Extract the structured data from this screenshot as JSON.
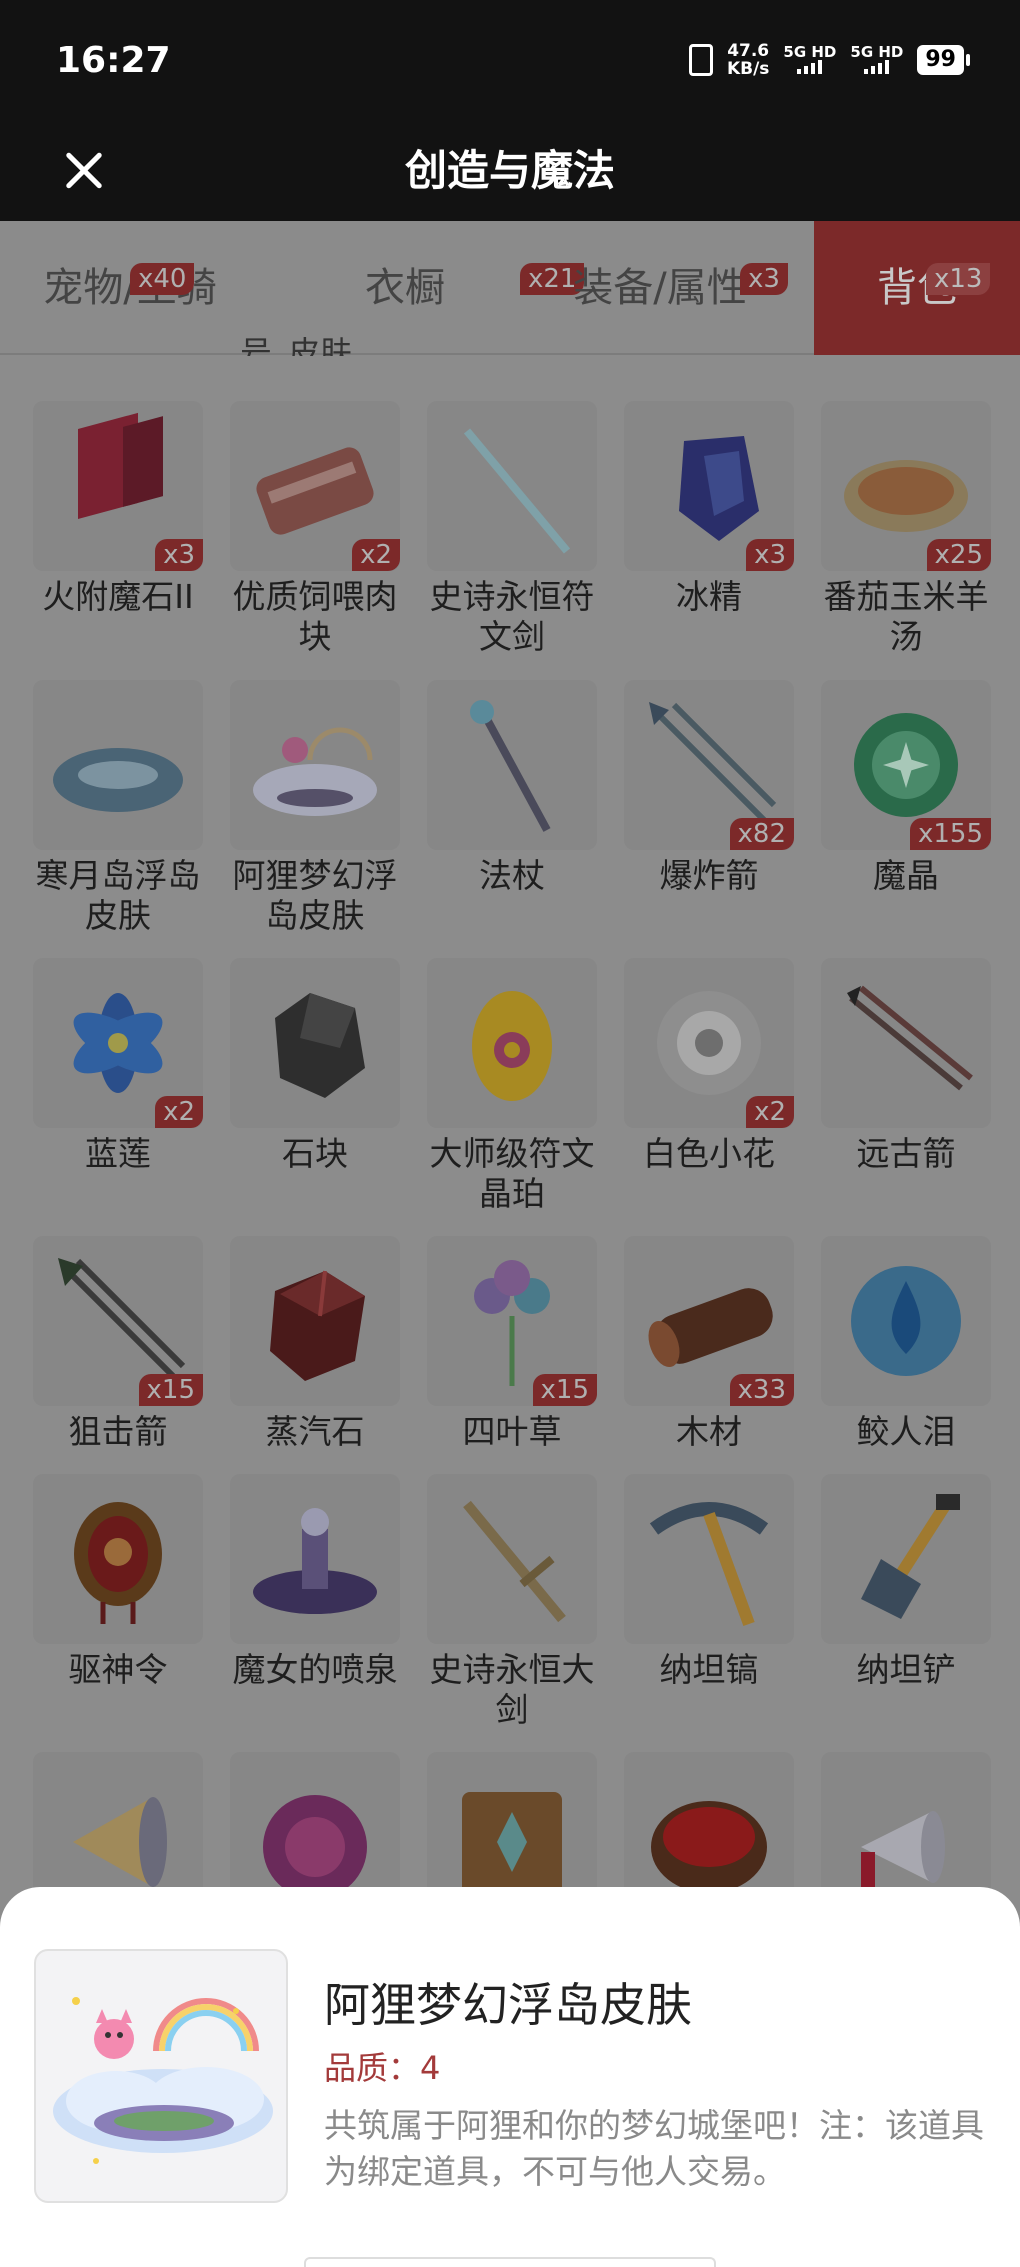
{
  "status_bar": {
    "time": "16:27",
    "speed_value": "47.6",
    "speed_unit": "KB/s",
    "net1": "5G HD",
    "net2": "5G HD",
    "battery": "99"
  },
  "header": {
    "title": "创造与魔法"
  },
  "tabs": [
    {
      "label": "宠物/坐骑",
      "badge": "x40",
      "active": false
    },
    {
      "label": "衣橱",
      "badge": "x21",
      "active": false
    },
    {
      "label": "装备/属性",
      "badge": "x3",
      "active": false
    },
    {
      "label": "背包",
      "badge": "x13",
      "active": true
    }
  ],
  "partial_text": "号_皮肤",
  "items": [
    {
      "name": "火附魔石II",
      "count": "x3",
      "icon": "red-crystal-icon"
    },
    {
      "name": "优质饲喂肉块",
      "count": "x2",
      "icon": "meat-icon"
    },
    {
      "name": "史诗永恒符文剑",
      "count": "",
      "icon": "rune-sword-icon"
    },
    {
      "name": "冰精",
      "count": "x3",
      "icon": "ice-crystal-icon"
    },
    {
      "name": "番茄玉米羊汤",
      "count": "x25",
      "icon": "soup-icon"
    },
    {
      "name": "寒月岛浮岛皮肤",
      "count": "",
      "icon": "floating-island-icon"
    },
    {
      "name": "阿狸梦幻浮岛皮肤",
      "count": "",
      "icon": "cloud-island-icon"
    },
    {
      "name": "法杖",
      "count": "",
      "icon": "staff-icon"
    },
    {
      "name": "爆炸箭",
      "count": "x82",
      "icon": "arrow-icon"
    },
    {
      "name": "魔晶",
      "count": "x155",
      "icon": "magic-crystal-icon"
    },
    {
      "name": "蓝莲",
      "count": "x2",
      "icon": "blue-lotus-icon"
    },
    {
      "name": "石块",
      "count": "",
      "icon": "stone-icon"
    },
    {
      "name": "大师级符文晶珀",
      "count": "",
      "icon": "amber-egg-icon"
    },
    {
      "name": "白色小花",
      "count": "x2",
      "icon": "white-flower-icon"
    },
    {
      "name": "远古箭",
      "count": "",
      "icon": "ancient-arrow-icon"
    },
    {
      "name": "狙击箭",
      "count": "x15",
      "icon": "sniper-arrow-icon"
    },
    {
      "name": "蒸汽石",
      "count": "",
      "icon": "steam-stone-icon"
    },
    {
      "name": "四叶草",
      "count": "x15",
      "icon": "clover-icon"
    },
    {
      "name": "木材",
      "count": "x33",
      "icon": "wood-log-icon"
    },
    {
      "name": "鲛人泪",
      "count": "",
      "icon": "water-drop-icon"
    },
    {
      "name": "驱神令",
      "count": "",
      "icon": "emblem-icon"
    },
    {
      "name": "魔女的喷泉",
      "count": "",
      "icon": "fountain-icon"
    },
    {
      "name": "史诗永恒大剑",
      "count": "",
      "icon": "great-sword-icon"
    },
    {
      "name": "纳坦镐",
      "count": "",
      "icon": "pickaxe-icon"
    },
    {
      "name": "纳坦铲",
      "count": "",
      "icon": "shovel-icon"
    },
    {
      "name": "",
      "count": "",
      "icon": "megaphone-icon"
    },
    {
      "name": "",
      "count": "",
      "icon": "berry-icon"
    },
    {
      "name": "",
      "count": "",
      "icon": "scroll-icon"
    },
    {
      "name": "",
      "count": "",
      "icon": "red-drum-icon"
    },
    {
      "name": "",
      "count": "",
      "icon": "loudspeaker-icon"
    }
  ],
  "detail": {
    "name": "阿狸梦幻浮岛皮肤",
    "quality": "品质：4",
    "description": "共筑属于阿狸和你的梦幻城堡吧！注：该道具为绑定道具，不可与他人交易。",
    "icon": "cloud-island-icon"
  }
}
